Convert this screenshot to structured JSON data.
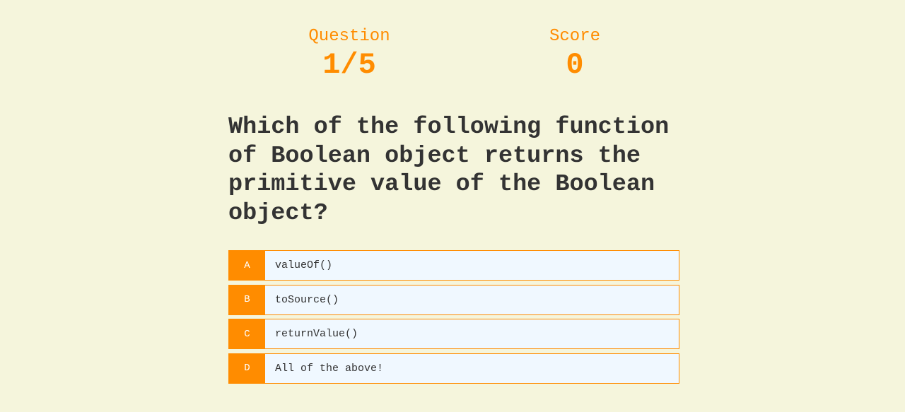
{
  "hud": {
    "question_label": "Question",
    "question_value": "1/5",
    "score_label": "Score",
    "score_value": "0"
  },
  "question": "Which of the following function of Boolean object returns the primitive value of the Boolean object?",
  "choices": [
    {
      "prefix": "A",
      "text": "valueOf()"
    },
    {
      "prefix": "B",
      "text": "toSource()"
    },
    {
      "prefix": "C",
      "text": "returnValue()"
    },
    {
      "prefix": "D",
      "text": "All of the above!"
    }
  ],
  "colors": {
    "background": "#f5f5dc",
    "accent": "#ff8c00",
    "text": "#333333",
    "choice_background": "#f0f8ff"
  }
}
